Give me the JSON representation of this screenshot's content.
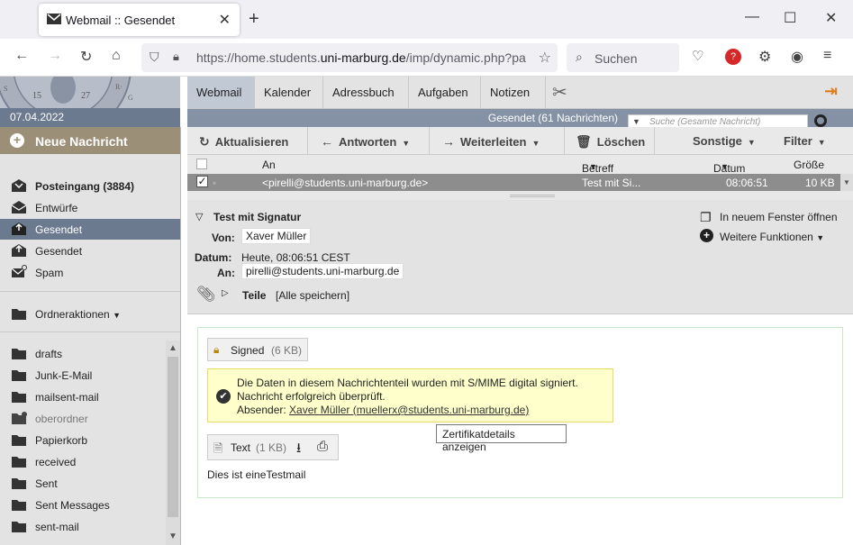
{
  "browser": {
    "tab_title": "Webmail :: Gesendet",
    "url_prefix": "https://home.students.",
    "url_domain": "uni-marburg.de",
    "url_suffix": "/imp/dynamic.php?pa",
    "search_placeholder": "Suchen"
  },
  "apps": [
    "Webmail",
    "Kalender",
    "Adressbuch",
    "Aufgaben",
    "Notizen"
  ],
  "date": "07.04.2022",
  "mailbox_title": "Gesendet (61 Nachrichten)",
  "quicksearch_placeholder": "Suche (Gesamte Nachricht)",
  "new_message": "Neue Nachricht",
  "folders": [
    {
      "label": "Posteingang (3884)",
      "bold": true
    },
    {
      "label": "Entwürfe"
    },
    {
      "label": "Gesendet",
      "active": true
    },
    {
      "label": "Gesendet"
    },
    {
      "label": "Spam"
    }
  ],
  "folder_actions": "Ordneraktionen",
  "subfolders": [
    "drafts",
    "Junk-E-Mail",
    "mailsent-mail",
    "oberordner",
    "Papierkorb",
    "received",
    "Sent",
    "Sent Messages",
    "sent-mail"
  ],
  "toolbar": {
    "refresh": "Aktualisieren",
    "reply": "Antworten",
    "forward": "Weiterleiten",
    "delete": "Löschen",
    "other": "Sonstige",
    "filter": "Filter"
  },
  "list_columns": {
    "to": "An",
    "subject": "Betreff",
    "date": "Datum",
    "size": "Größe"
  },
  "list_row": {
    "to": "<pirelli@students.uni-marburg.de>",
    "subject": "Test mit Si...",
    "date": "08:06:51",
    "size": "10 KB"
  },
  "message": {
    "subject": "Test mit Signatur",
    "from_label": "Von:",
    "from": "Xaver Müller",
    "date_label": "Datum:",
    "date": "Heute, 08:06:51 CEST",
    "to_label": "An:",
    "to": "pirelli@students.uni-marburg.de",
    "parts_label": "Teile",
    "save_all": "[Alle speichern]",
    "open_new_window": "In neuem Fenster öffnen",
    "more_functions": "Weitere Funktionen",
    "signed_part": "Signed",
    "signed_size": "(6 KB)",
    "smime_line1": "Die Daten in diesem Nachrichtenteil wurden mit S/MIME digital signiert.",
    "smime_line2": "Nachricht erfolgreich überprüft.",
    "smime_sender_label": "Absender:",
    "smime_sender": "Xaver Müller (muellerx@students.uni-marburg.de)",
    "tooltip": "Zertifikatdetails anzeigen",
    "text_part": "Text",
    "text_size": "(1 KB)",
    "body": "Dies ist eineTestmail"
  }
}
